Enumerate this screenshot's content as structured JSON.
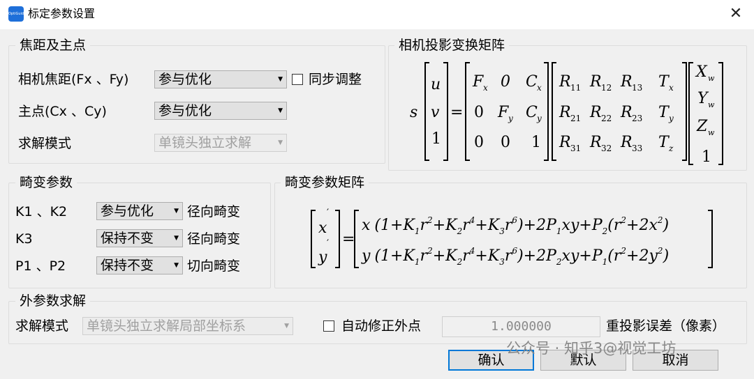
{
  "window": {
    "title": "标定参数设置",
    "icon_text": "OptiGuide",
    "close_glyph": "✕"
  },
  "intrinsic": {
    "group_label": "焦距及主点",
    "focal_label": "相机焦距(Fx 、Fy)",
    "focal_value": "参与优化",
    "sync_label": "同步调整",
    "principal_label": "主点(Cx 、Cy)",
    "principal_value": "参与优化",
    "solve_label": "求解模式",
    "solve_value": "单镜头独立求解"
  },
  "projection": {
    "group_label": "相机投影变换矩阵",
    "s": "s",
    "lhs": [
      "u",
      "v",
      "1"
    ],
    "K": [
      [
        "F",
        "0",
        "C"
      ],
      [
        "0",
        "F",
        "C"
      ],
      [
        "0",
        "0",
        "1"
      ]
    ],
    "K_subs": [
      "x",
      "x",
      "y",
      "y"
    ],
    "R_letters": [
      "R",
      "T"
    ],
    "R_subs": [
      [
        "11",
        "12",
        "13",
        "x"
      ],
      [
        "21",
        "22",
        "23",
        "y"
      ],
      [
        "31",
        "32",
        "33",
        "z"
      ]
    ],
    "world": [
      "X",
      "Y",
      "Z",
      "1"
    ],
    "world_sub": "w",
    "eq": "="
  },
  "distortion": {
    "group_label": "畸变参数",
    "rows": [
      {
        "label": "K1 、K2",
        "value": "参与优化",
        "desc": "径向畸变"
      },
      {
        "label": "K3",
        "value": "保持不变",
        "desc": "径向畸变"
      },
      {
        "label": "P1 、P2",
        "value": "保持不变",
        "desc": "切向畸变"
      }
    ]
  },
  "distortion_matrix": {
    "group_label": "畸变参数矩阵",
    "row1": {
      "var": "x",
      "open": "(1+",
      "K1": "K",
      "K1_sub": "1",
      "r": "r",
      "p2": "2",
      "plus": "+",
      "K2": "K",
      "K2_sub": "2",
      "p4": "4",
      "K3": "K",
      "K3_sub": "3",
      "p6": "6",
      "tail1": ")+2",
      "P1": "P",
      "P1_sub": "1",
      "xy": "xy",
      "P2": "P",
      "P2_sub": "2",
      "inner": "(",
      "plus2": "+2",
      "sq": "x",
      "close": ")"
    },
    "row2": {
      "var": "y",
      "open": "(1+",
      "K1": "K",
      "K1_sub": "1",
      "r": "r",
      "p2": "2",
      "plus": "+",
      "K2": "K",
      "K2_sub": "2",
      "p4": "4",
      "K3": "K",
      "K3_sub": "3",
      "p6": "6",
      "tail1": ")+2",
      "P1": "P",
      "P1_sub": "2",
      "xy": "xy",
      "P2": "P",
      "P2_sub": "1",
      "inner": "(",
      "plus2": "+2",
      "sq": "y",
      "close": ")"
    },
    "lhs": [
      "x",
      "y"
    ],
    "prime": "′",
    "eq": "="
  },
  "extrinsic": {
    "group_label": "外参数求解",
    "solve_label": "求解模式",
    "solve_value": "单镜头独立求解局部坐标系",
    "auto_label": "自动修正外点",
    "threshold_value": "1.000000",
    "reproj_label": "重投影误差（像素）"
  },
  "buttons": {
    "ok": "确认",
    "default": "默认",
    "cancel": "取消"
  },
  "watermark": "公众号 · 知乎3@视觉工坊"
}
